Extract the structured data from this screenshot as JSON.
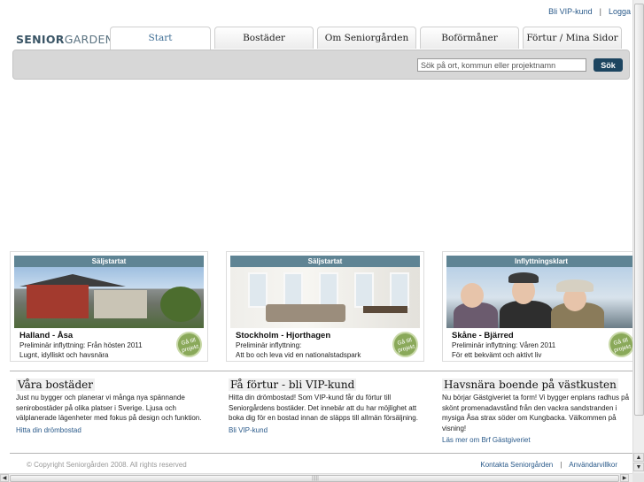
{
  "toplinks": {
    "vip": "Bli VIP-kund",
    "separator": "|",
    "login": "Logga"
  },
  "logo": {
    "part1": "SENIOR",
    "part2": "GARDEN"
  },
  "tabs": [
    {
      "label": "Start",
      "active": true
    },
    {
      "label": "Bostäder",
      "active": false
    },
    {
      "label": "Om Seniorgården",
      "active": false
    },
    {
      "label": "Boförmåner",
      "active": false
    },
    {
      "label": "Förtur / Mina Sidor",
      "active": false
    }
  ],
  "search": {
    "placeholder": "Sök på ort, kommun eller projektnamn",
    "button": "Sök"
  },
  "cards": [
    {
      "badge": "Säljstartat",
      "title": "Halland - Åsa",
      "line1": "Preliminär inflyttning: Från hösten 2011",
      "line2": "Lugnt, idylliskt och havsnära",
      "goto": "Gå till projekt"
    },
    {
      "badge": "Säljstartat",
      "title": "Stockholm - Hjorthagen",
      "line1": "Preliminär inflyttning:",
      "line2": "Att bo och leva vid en nationalstadspark",
      "goto": "Gå till projekt"
    },
    {
      "badge": "Inflyttningsklart",
      "title": "Skåne - Bjärred",
      "line1": "Preliminär inflyttning: Våren 2011",
      "line2": "För ett bekvämt och aktivt liv",
      "goto": "Gå till projekt"
    }
  ],
  "columns": [
    {
      "heading": "Våra bostäder",
      "text": "Just nu bygger och planerar vi många nya spännande senirobostäder på olika platser i Sverige. Ljusa och välplanerade lägenheter med fokus på design och funktion.",
      "link": "Hitta din drömbostad"
    },
    {
      "heading": "Få förtur - bli VIP-kund",
      "text": "Hitta din drömbostad! Som VIP-kund får du förtur till Seniorgårdens bostäder. Det innebär att du har möjlighet att boka dig för en bostad innan de släpps till allmän försäljning.",
      "link": "Bli VIP-kund"
    },
    {
      "heading": "Havsnära boende på västkusten",
      "text": "Nu börjar Gästgiveriet ta form! Vi bygger enplans radhus på skönt promenadavstånd från den vackra sandstranden i mysiga Åsa strax söder om Kungbacka. Välkommen på visning!",
      "link": "Läs mer om Brf Gästgiveriet"
    }
  ],
  "footer": {
    "copyright": "© Copyright Seniorgården 2008. All rights reserved",
    "contact": "Kontakta Seniorgården",
    "separator": "|",
    "terms": "Användarvillkor"
  }
}
